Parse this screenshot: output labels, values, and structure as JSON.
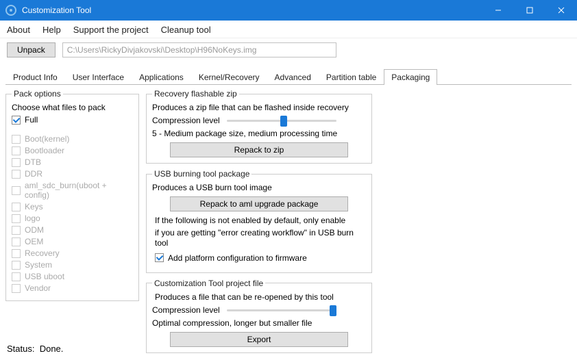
{
  "window": {
    "title": "Customization Tool"
  },
  "menu": {
    "about": "About",
    "help": "Help",
    "support": "Support the project",
    "cleanup": "Cleanup tool"
  },
  "toolbar": {
    "unpack": "Unpack",
    "path": "C:\\Users\\RickyDivjakovski\\Desktop\\H96NoKeys.img"
  },
  "tabs": {
    "product": "Product Info",
    "ui": "User Interface",
    "apps": "Applications",
    "kernel": "Kernel/Recovery",
    "advanced": "Advanced",
    "partition": "Partition table",
    "packaging": "Packaging"
  },
  "pack": {
    "legend": "Pack options",
    "subtitle": "Choose what files to pack",
    "items": {
      "full": "Full",
      "boot": "Boot(kernel)",
      "bootloader": "Bootloader",
      "dtb": "DTB",
      "ddr": "DDR",
      "amlsdc": "aml_sdc_burn(uboot + config)",
      "keys": "Keys",
      "logo": "logo",
      "odm": "ODM",
      "oem": "OEM",
      "recovery": "Recovery",
      "system": "System",
      "usbuboot": "USB uboot",
      "vendor": "Vendor"
    }
  },
  "flashable": {
    "legend": "Recovery flashable zip",
    "desc": "Produces a zip file that can be flashed inside recovery",
    "comp_label": "Compression level",
    "comp_desc": "5 - Medium package size, medium processing time",
    "btn": "Repack to zip"
  },
  "usb": {
    "legend": "USB burning tool package",
    "desc": "Produces a USB burn tool image",
    "btn": "Repack to aml upgrade package",
    "note1": "If the following is not enabled by default, only enable",
    "note2": "if you are getting \"error creating workflow\" in USB burn tool",
    "chk": "Add platform configuration to firmware"
  },
  "project": {
    "legend": "Customization Tool project file",
    "desc": "Produces a file that can be re-opened by this tool",
    "comp_label": "Compression level",
    "comp_desc": "Optimal compression, longer but smaller file",
    "btn": "Export"
  },
  "status": {
    "label": "Status:",
    "value": "Done."
  }
}
